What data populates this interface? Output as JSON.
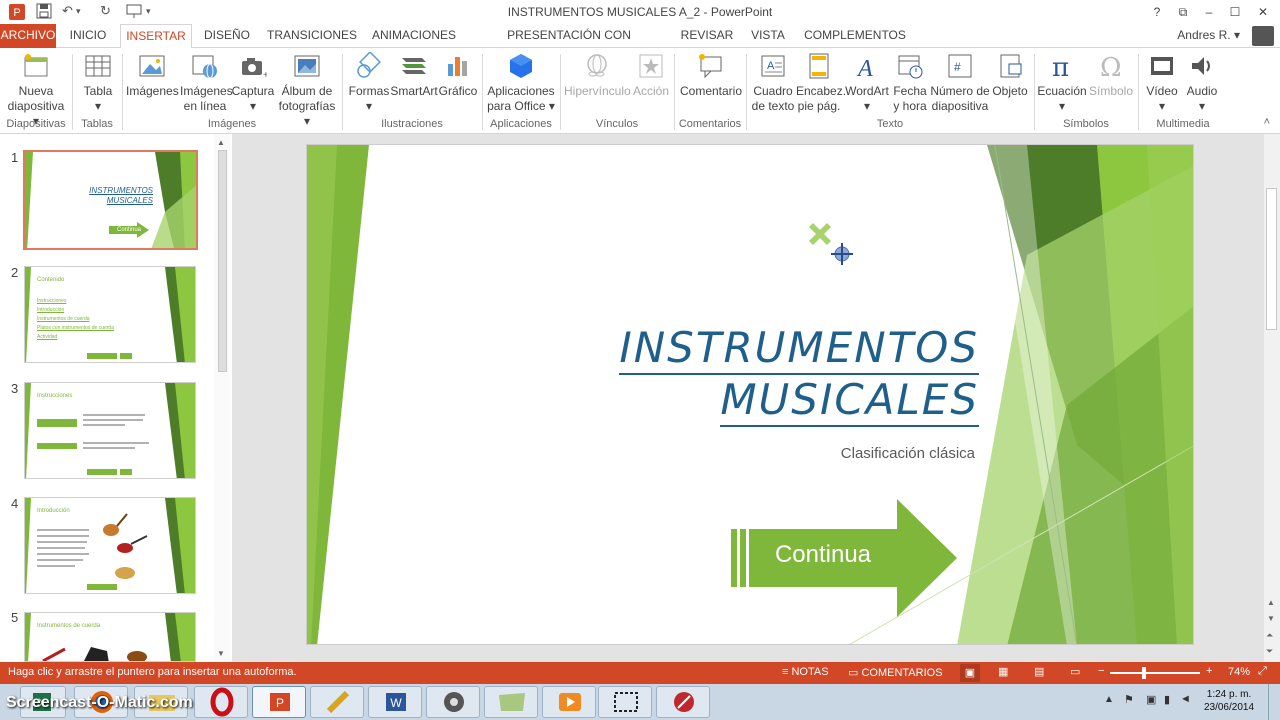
{
  "window": {
    "title": "INSTRUMENTOS MUSICALES A_2 - PowerPoint",
    "help": "?",
    "min": "–",
    "max": "☐",
    "close": "✕",
    "restore": "⧉"
  },
  "tabs": [
    "ARCHIVO",
    "INICIO",
    "INSERTAR",
    "DISEÑO",
    "TRANSICIONES",
    "ANIMACIONES",
    "PRESENTACIÓN CON DIAPOSITIVAS",
    "REVISAR",
    "VISTA",
    "COMPLEMENTOS"
  ],
  "user": "Andres R. ▾",
  "ribbon": {
    "buttons": [
      {
        "l1": "Nueva",
        "l2": "diapositiva ▾"
      },
      {
        "l1": "Tabla",
        "l2": "▾"
      },
      {
        "l1": "Imágenes",
        "l2": ""
      },
      {
        "l1": "Imágenes",
        "l2": "en línea"
      },
      {
        "l1": "Captura",
        "l2": "▾"
      },
      {
        "l1": "Álbum de",
        "l2": "fotografías ▾"
      },
      {
        "l1": "Formas",
        "l2": "▾"
      },
      {
        "l1": "SmartArt",
        "l2": ""
      },
      {
        "l1": "Gráfico",
        "l2": ""
      },
      {
        "l1": "Aplicaciones",
        "l2": "para Office ▾"
      },
      {
        "l1": "Hipervínculo",
        "l2": ""
      },
      {
        "l1": "Acción",
        "l2": ""
      },
      {
        "l1": "Comentario",
        "l2": ""
      },
      {
        "l1": "Cuadro",
        "l2": "de texto"
      },
      {
        "l1": "Encabez.",
        "l2": "pie pág."
      },
      {
        "l1": "WordArt",
        "l2": "▾"
      },
      {
        "l1": "Fecha",
        "l2": "y hora"
      },
      {
        "l1": "Número de",
        "l2": "diapositiva"
      },
      {
        "l1": "Objeto",
        "l2": ""
      },
      {
        "l1": "Ecuación",
        "l2": "▾"
      },
      {
        "l1": "Símbolo",
        "l2": ""
      },
      {
        "l1": "Vídeo",
        "l2": "▾"
      },
      {
        "l1": "Audio",
        "l2": "▾"
      }
    ],
    "groups": [
      "Diapositivas",
      "Tablas",
      "Imágenes",
      "Ilustraciones",
      "Aplicaciones",
      "Vínculos",
      "Comentarios",
      "Texto",
      "Símbolos",
      "Multimedia"
    ]
  },
  "thumbnails": [
    {
      "num": "1",
      "title1": "INSTRUMENTOS",
      "title2": "MUSICALES",
      "button": "Continua"
    },
    {
      "num": "2",
      "title": "Contenido",
      "items": [
        "Instrucciones",
        "Introducción",
        "Instrumentos de cuerda",
        "Platos con instrumentos de cuerda",
        "Actividad"
      ]
    },
    {
      "num": "3",
      "title": "Instrucciones"
    },
    {
      "num": "4",
      "title": "Introducción"
    },
    {
      "num": "5",
      "title": "Instrumentos de cuerda"
    }
  ],
  "slide": {
    "title1": "INSTRUMENTOS",
    "title2": "MUSICALES",
    "subtitle": "Clasificación clásica",
    "button": "Continua"
  },
  "status": {
    "hint": "Haga clic y arrastre el puntero para insertar una autoforma.",
    "notes": "NOTAS",
    "comments": "COMENTARIOS",
    "zoom": "74%",
    "minus": "−",
    "plus": "+"
  },
  "taskbar": {
    "time": "1:24 p. m.",
    "date": "23/06/2014",
    "watermark": "Screencast-O-Matic.com"
  },
  "colors": {
    "accent": "#d24726",
    "green": "#7fb73a",
    "title_blue": "#1f5f8b"
  }
}
